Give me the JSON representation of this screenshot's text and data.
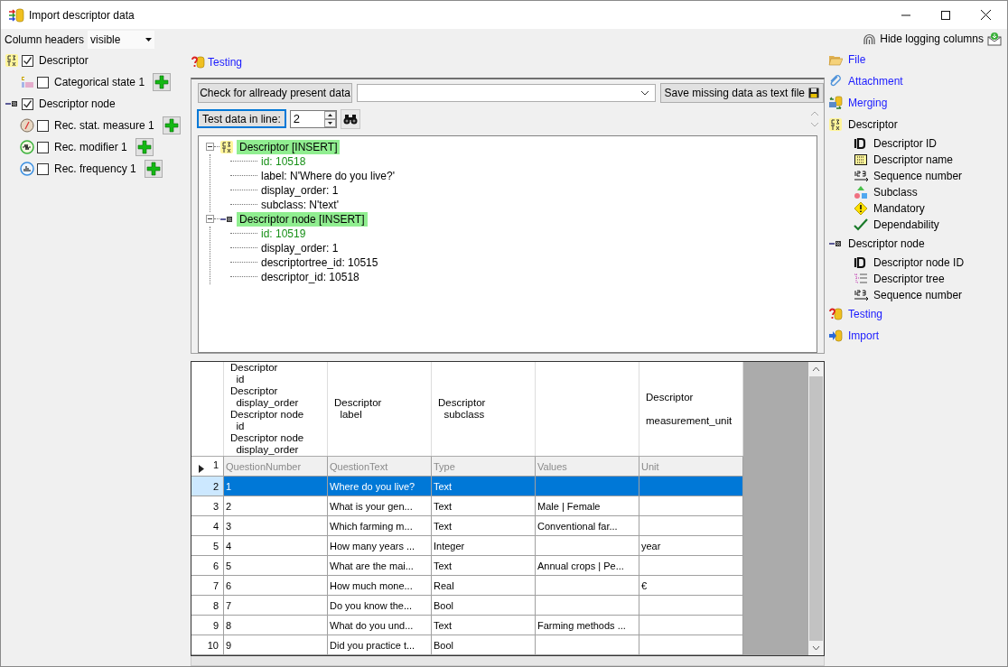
{
  "window": {
    "title": "Import descriptor data"
  },
  "options": {
    "label": "Column headers",
    "value": "visible"
  },
  "logging": {
    "label": "Hide logging columns"
  },
  "left_tree": [
    {
      "kind": "descriptor",
      "label": "Descriptor",
      "checked": true,
      "add": false,
      "children": [
        {
          "kind": "categorical_state",
          "label": "Categorical state 1",
          "checked": false,
          "add": true
        }
      ]
    },
    {
      "kind": "descriptor_node",
      "label": "Descriptor node",
      "checked": true,
      "add": false,
      "children": [
        {
          "kind": "statistical_measure",
          "label": "Rec. stat. measure 1",
          "checked": false,
          "add": true
        },
        {
          "kind": "modifier",
          "label": "Rec. modifier 1",
          "checked": false,
          "add": true
        },
        {
          "kind": "frequency",
          "label": "Rec. frequency 1",
          "checked": false,
          "add": true
        }
      ]
    }
  ],
  "testing": {
    "title": "Testing",
    "check_button": "Check for allready present data",
    "save_button": "Save missing data as text file",
    "line_button": "Test data in line:",
    "line_value": "2"
  },
  "result_tree": [
    {
      "kind": "descriptor",
      "label": "Descriptor [INSERT]",
      "highlighted": true,
      "children": [
        {
          "kind": "id",
          "text": "id: 10518"
        },
        {
          "kind": "field",
          "text": "label: N'Where do you live?'"
        },
        {
          "kind": "field",
          "text": "display_order: 1"
        },
        {
          "kind": "field",
          "text": "subclass: N'text'"
        }
      ]
    },
    {
      "kind": "descriptor_node",
      "label": "Descriptor node [INSERT]",
      "highlighted": true,
      "children": [
        {
          "kind": "id",
          "text": "id: 10519"
        },
        {
          "kind": "field",
          "text": "display_order: 1"
        },
        {
          "kind": "field",
          "text": "descriptortree_id: 10515"
        },
        {
          "kind": "field",
          "text": "descriptor_id: 10518"
        }
      ]
    }
  ],
  "grid": {
    "columns": [
      {
        "header": "Descriptor\n  id\nDescriptor\n  display_order\nDescriptor node\n  id\nDescriptor node\n  display_order"
      },
      {
        "header": "Descriptor\n  label"
      },
      {
        "header": "Descriptor\n  subclass"
      },
      {},
      {
        "header": "Descriptor\n\nmeasurement_unit"
      }
    ],
    "rows": [
      {
        "number": "1",
        "kind": "names",
        "current": true,
        "selected": false,
        "cells": [
          "QuestionNumber",
          "QuestionText",
          "Type",
          "Values",
          "Unit"
        ]
      },
      {
        "number": "2",
        "kind": "data",
        "current": false,
        "selected": true,
        "cells": [
          "1",
          "Where do you live?",
          "Text",
          null,
          null
        ]
      },
      {
        "number": "3",
        "kind": "data",
        "current": false,
        "selected": false,
        "cells": [
          "2",
          "What is your gen...",
          "Text",
          "Male | Female",
          null
        ]
      },
      {
        "number": "4",
        "kind": "data",
        "current": false,
        "selected": false,
        "cells": [
          "3",
          "Which farming m...",
          "Text",
          "Conventional far...",
          null
        ]
      },
      {
        "number": "5",
        "kind": "data",
        "current": false,
        "selected": false,
        "cells": [
          "4",
          "How many years ...",
          "Integer",
          null,
          "year"
        ]
      },
      {
        "number": "6",
        "kind": "data",
        "current": false,
        "selected": false,
        "cells": [
          "5",
          "What are the mai...",
          "Text",
          "Annual crops | Pe...",
          null
        ]
      },
      {
        "number": "7",
        "kind": "data",
        "current": false,
        "selected": false,
        "cells": [
          "6",
          "How much mone...",
          "Real",
          null,
          "€"
        ]
      },
      {
        "number": "8",
        "kind": "data",
        "current": false,
        "selected": false,
        "cells": [
          "7",
          "Do you know the...",
          "Bool",
          null,
          null
        ]
      },
      {
        "number": "9",
        "kind": "data",
        "current": false,
        "selected": false,
        "cells": [
          "8",
          "What do you und...",
          "Text",
          "Farming methods ...",
          null
        ]
      },
      {
        "number": "10",
        "kind": "data",
        "current": false,
        "selected": false,
        "cells": [
          "9",
          "Did you practice t...",
          "Bool",
          null,
          null
        ]
      }
    ]
  },
  "nav": [
    {
      "kind": "file",
      "label": "File",
      "link": true
    },
    {
      "kind": "attachment",
      "label": "Attachment",
      "link": true
    },
    {
      "kind": "merging",
      "label": "Merging",
      "link": true
    },
    {
      "kind": "descriptor",
      "label": "Descriptor",
      "link": false,
      "children": [
        {
          "kind": "id",
          "label": "Descriptor ID"
        },
        {
          "kind": "name",
          "label": "Descriptor name"
        },
        {
          "kind": "sequence",
          "label": "Sequence number"
        },
        {
          "kind": "subclass",
          "label": "Subclass"
        },
        {
          "kind": "mandatory",
          "label": "Mandatory"
        },
        {
          "kind": "dependability",
          "label": "Dependability"
        }
      ]
    },
    {
      "kind": "descriptor_node",
      "label": "Descriptor node",
      "link": false,
      "children": [
        {
          "kind": "id",
          "label": "Descriptor node ID"
        },
        {
          "kind": "tree",
          "label": "Descriptor tree"
        },
        {
          "kind": "sequence",
          "label": "Sequence number"
        }
      ]
    },
    {
      "kind": "testing",
      "label": "Testing",
      "link": true
    },
    {
      "kind": "import",
      "label": "Import",
      "link": true
    }
  ]
}
